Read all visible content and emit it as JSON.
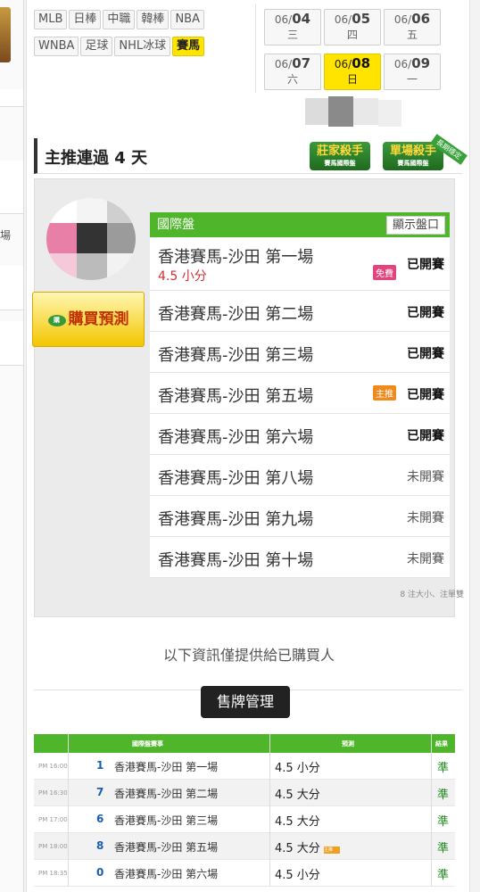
{
  "leagues": [
    "MLB",
    "日棒",
    "中職",
    "韓棒",
    "NBA",
    "WNBA",
    "足球",
    "NHL冰球",
    "賽馬"
  ],
  "active_league": "賽馬",
  "dates": [
    {
      "md": "06/",
      "d": "04",
      "w": "三"
    },
    {
      "md": "06/",
      "d": "05",
      "w": "四"
    },
    {
      "md": "06/",
      "d": "06",
      "w": "五"
    },
    {
      "md": "06/",
      "d": "07",
      "w": "六"
    },
    {
      "md": "06/",
      "d": "08",
      "w": "日",
      "active": true
    },
    {
      "md": "06/",
      "d": "09",
      "w": "一"
    }
  ],
  "section": {
    "title": "主推連過 4 天",
    "badge1": "莊家殺手",
    "badge1_sub": "賽馬國際盤",
    "badge2": "單場殺手",
    "badge2_sub": "賽馬國際盤",
    "ribbon": "長期穩定"
  },
  "buy_button": "購買預測",
  "buy_coin": "購",
  "market": {
    "title": "國際盤",
    "show_button": "顯示盤口",
    "rows": [
      {
        "name": "香港賽馬-沙田 第一場",
        "sub": "4.5 小分",
        "tag": "免費",
        "tag_color": "pink",
        "status": "已開賽",
        "started": true
      },
      {
        "name": "香港賽馬-沙田 第二場",
        "status": "已開賽",
        "started": true
      },
      {
        "name": "香港賽馬-沙田 第三場",
        "status": "已開賽",
        "started": true
      },
      {
        "name": "香港賽馬-沙田 第五場",
        "tag": "主推",
        "tag_color": "orange",
        "status": "已開賽",
        "started": true
      },
      {
        "name": "香港賽馬-沙田 第六場",
        "status": "已開賽",
        "started": true
      },
      {
        "name": "香港賽馬-沙田 第八場",
        "status": "未開賽",
        "started": false
      },
      {
        "name": "香港賽馬-沙田 第九場",
        "status": "未開賽",
        "started": false
      },
      {
        "name": "香港賽馬-沙田 第十場",
        "status": "未開賽",
        "started": false
      }
    ],
    "footnote": "8 注大小、注單雙"
  },
  "info_text": "以下資訊僅提供給已購買人",
  "manage_button": "售牌管理",
  "history": {
    "headers": {
      "game": "國際盤賽事",
      "pred": "預測",
      "result": "結果"
    },
    "rows": [
      {
        "time": "PM 16:00",
        "num": "1",
        "game": "香港賽馬-沙田 第一場",
        "pred": "4.5 小分",
        "result": "準"
      },
      {
        "time": "PM 16:30",
        "num": "7",
        "game": "香港賽馬-沙田 第二場",
        "pred": "4.5 大分",
        "result": "準"
      },
      {
        "time": "PM 17:00",
        "num": "6",
        "game": "香港賽馬-沙田 第三場",
        "pred": "4.5 大分",
        "result": "準"
      },
      {
        "time": "PM 18:00",
        "num": "8",
        "game": "香港賽馬-沙田 第五場",
        "pred": "4.5 大分",
        "hot": true,
        "hot_label": "主推",
        "result": "準"
      },
      {
        "time": "PM 18:35",
        "num": "0",
        "game": "香港賽馬-沙田 第六場",
        "pred": "4.5 小分",
        "result": "準"
      }
    ]
  },
  "left_char": "場"
}
